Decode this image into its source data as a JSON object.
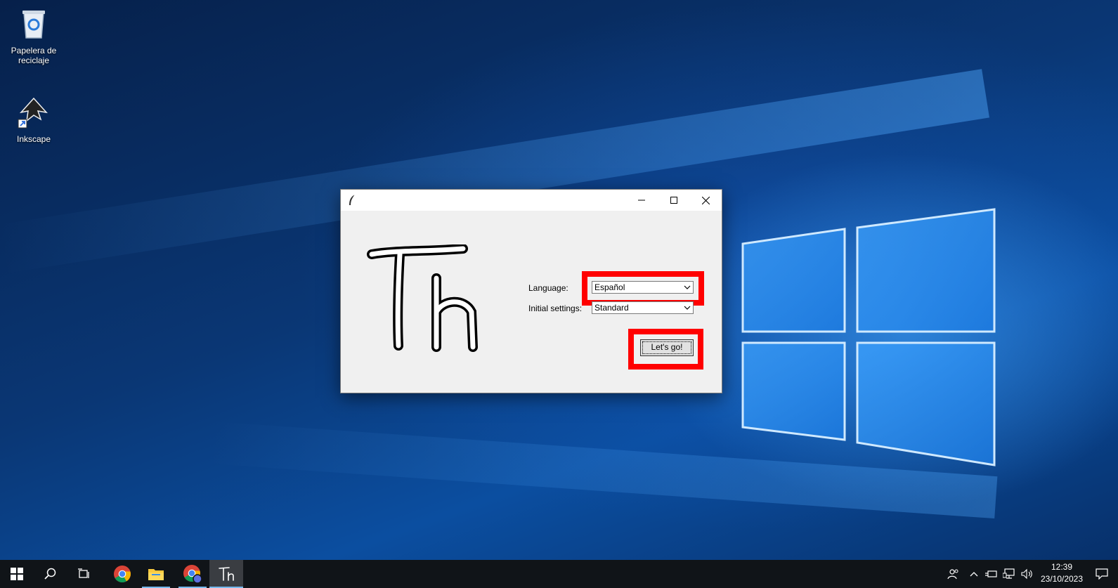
{
  "desktop": {
    "icons": [
      {
        "label": "Papelera de reciclaje",
        "icon": "recycle-bin-icon"
      },
      {
        "label": "Inkscape",
        "icon": "inkscape-icon"
      }
    ]
  },
  "window": {
    "title": "",
    "app_logo_text": "Th",
    "language_label": "Language:",
    "language_value": "Español",
    "settings_label": "Initial settings:",
    "settings_value": "Standard",
    "go_button": "Let's go!",
    "highlight_color": "#ff0000"
  },
  "taskbar": {
    "items": [
      "start-icon",
      "search-icon",
      "task-view-icon",
      "chrome-icon",
      "file-explorer-icon",
      "chrome-profile-icon",
      "thonny-app-icon"
    ],
    "time": "12:39",
    "date": "23/10/2023"
  }
}
